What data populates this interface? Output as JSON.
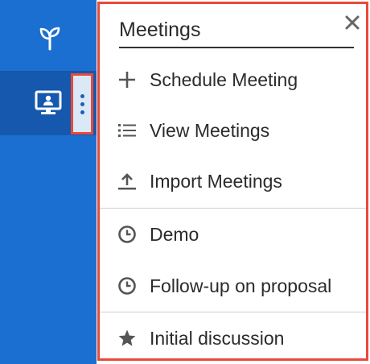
{
  "sidebar": {
    "top_icon": "sprout-icon",
    "active_module_icon": "presentation-monitor-icon",
    "more_icon": "vertical-ellipsis-icon",
    "bg_color": "#1b6fd1",
    "active_bg_color": "#1558ae"
  },
  "menu": {
    "title": "Meetings",
    "close_icon": "close-icon",
    "actions": [
      {
        "label": "Schedule Meeting",
        "icon": "plus-icon"
      },
      {
        "label": "View Meetings",
        "icon": "list-icon"
      },
      {
        "label": "Import Meetings",
        "icon": "upload-icon"
      }
    ],
    "recently_viewed": [
      {
        "label": "Demo",
        "icon": "clock-icon"
      },
      {
        "label": "Follow-up on proposal",
        "icon": "clock-icon"
      }
    ],
    "favorites": [
      {
        "label": "Initial discussion",
        "icon": "star-icon"
      }
    ]
  },
  "highlight_color": "#e84a3a"
}
